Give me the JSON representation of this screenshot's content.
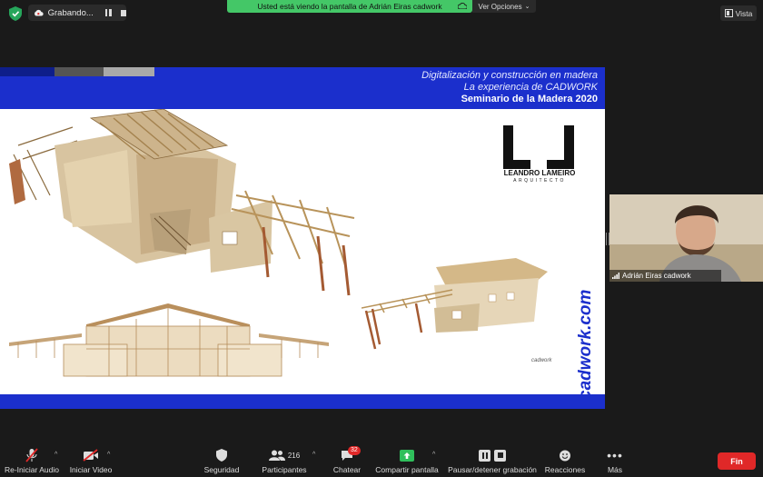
{
  "meeting": {
    "recording_label": "Grabando...",
    "share_banner": "Usted está viendo la pantalla de Adrián Eiras cadwork",
    "options_label": "Ver Opciones",
    "view_label": "Vista"
  },
  "slide": {
    "header_line1": "Digitalización y construcción en madera",
    "header_line2": "La experiencia de CADWORK",
    "header_line3": "Seminario de la Madera 2020",
    "logo_name": "LEANDRO LAMEIRO",
    "logo_sub": "ARQUITECTO",
    "brand_vertical": "cadwork.com",
    "brand_small": "cadwork",
    "colors": {
      "header": "#1b2fcc",
      "strip": [
        "#0e1e8a",
        "#555555",
        "#a9a9a9"
      ]
    }
  },
  "participant": {
    "name": "Adrián Eiras cadwork"
  },
  "toolbar": {
    "audio": "Re-Iniciar Audio",
    "video": "Iniciar Video",
    "security": "Seguridad",
    "participants": "Participantes",
    "participants_count": "216",
    "chat": "Chatear",
    "chat_badge": "32",
    "share": "Compartir pantalla",
    "record": "Pausar/detener grabación",
    "reactions": "Reacciones",
    "more": "Más",
    "end": "Fin"
  }
}
